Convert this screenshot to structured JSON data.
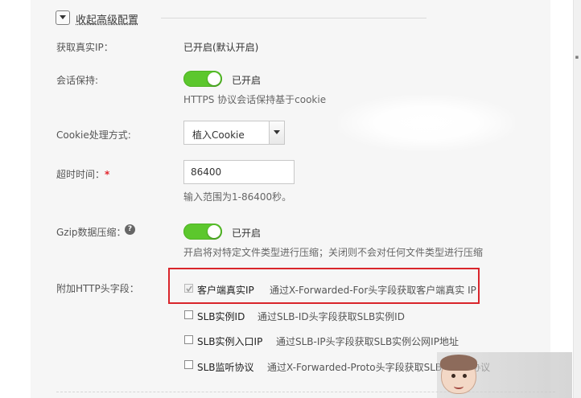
{
  "section": {
    "collapse_label": "收起高级配置"
  },
  "form": {
    "real_ip": {
      "label": "获取真实IP：",
      "value": "已开启(默认开启)"
    },
    "session": {
      "label": "会话保持:",
      "switch_text": "已开启",
      "hint": "HTTPS 协议会话保持基于cookie",
      "enabled": true
    },
    "cookie_mode": {
      "label": "Cookie处理方式:",
      "selected": "植入Cookie"
    },
    "timeout": {
      "label": "超时时间：",
      "required_mark": "*",
      "value": "86400",
      "hint": "输入范围为1-86400秒。"
    },
    "gzip": {
      "label": "Gzip数据压缩：",
      "help_icon": "?",
      "switch_text": "已开启",
      "hint": "开启将对特定文件类型进行压缩；关闭则不会对任何文件类型进行压缩",
      "enabled": true
    },
    "http_headers": {
      "label": "附加HTTP头字段：",
      "options": [
        {
          "label": "客户端真实IP",
          "desc": "通过X-Forwarded-For头字段获取客户端真实 IP",
          "checked": true,
          "disabled": true
        },
        {
          "label": "SLB实例ID",
          "desc": "通过SLB-ID头字段获取SLB实例ID",
          "checked": false
        },
        {
          "label": "SLB实例入口IP",
          "desc": "通过SLB-IP头字段获取SLB实例公网IP地址",
          "checked": false
        },
        {
          "label": "SLB监听协议",
          "desc": "通过X-Forwarded-Proto头字段获取SLB的监听协议",
          "checked": false
        }
      ]
    }
  },
  "colors": {
    "switch_on": "#5cc72d",
    "highlight_box": "#d9252b",
    "required": "#e3262e"
  }
}
